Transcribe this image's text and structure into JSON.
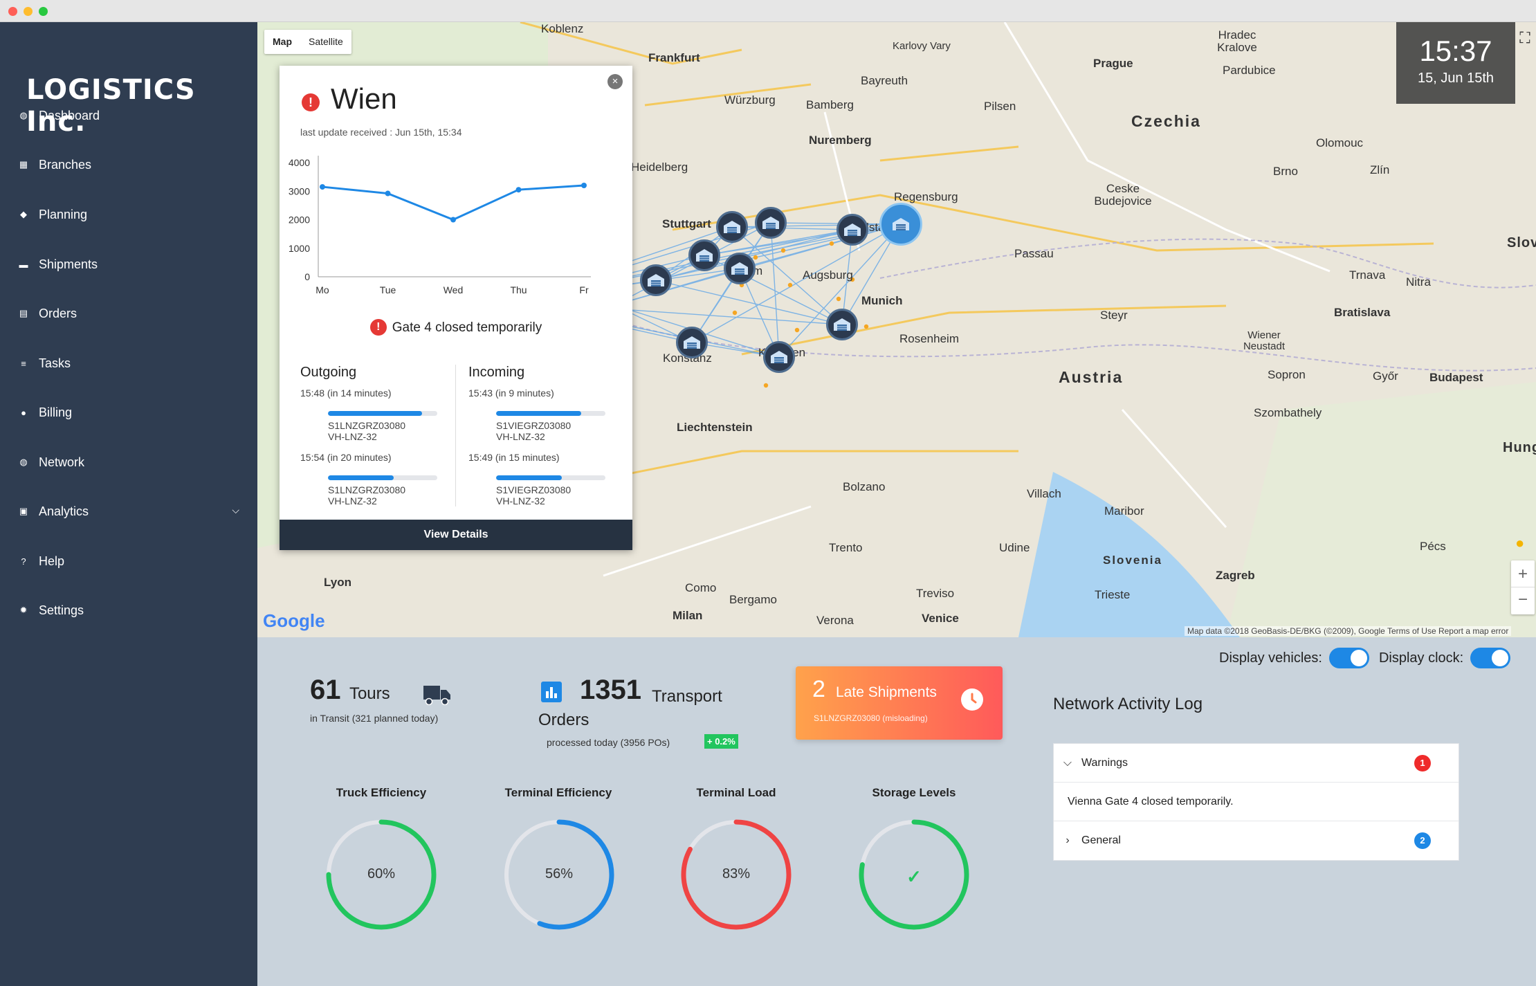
{
  "app": {
    "logo": "LOGISTICS Inc."
  },
  "nav": [
    {
      "label": "Dashboard",
      "icon": "globe-icon"
    },
    {
      "label": "Branches",
      "icon": "building-icon"
    },
    {
      "label": "Planning",
      "icon": "diamond-icon"
    },
    {
      "label": "Shipments",
      "icon": "truck-icon"
    },
    {
      "label": "Orders",
      "icon": "clipboard-icon"
    },
    {
      "label": "Tasks",
      "icon": "list-check-icon"
    },
    {
      "label": "Billing",
      "icon": "coin-icon"
    },
    {
      "label": "Network",
      "icon": "globe-icon"
    },
    {
      "label": "Analytics",
      "icon": "chart-icon"
    },
    {
      "label": "Help",
      "icon": "help-icon"
    },
    {
      "label": "Settings",
      "icon": "gear-icon"
    }
  ],
  "map": {
    "type_map": "Map",
    "type_satellite": "Satellite",
    "clock_time": "15:37",
    "clock_date": "15, Jun 15th",
    "attribution": "Map data ©2018 GeoBasis-DE/BKG (©2009), Google    Terms of Use    Report a map error",
    "google": "Google",
    "labels": {
      "czechia": "Czechia",
      "austria": "Austria",
      "slovenia": "Slovenia",
      "liechtenstein": "Liechtenstein",
      "prague": "Prague",
      "nuremberg": "Nuremberg",
      "munich": "Munich",
      "stuttgart": "Stuttgart",
      "frankfurt": "Frankfurt",
      "wurzburg": "Würzburg",
      "regensburg": "Regensburg",
      "ingolstadt": "Ingolstadt",
      "augsburg": "Augsburg",
      "passau": "Passau",
      "bratislava": "Bratislava",
      "budapest": "Budapest",
      "brno": "Brno",
      "zagreb": "Zagreb",
      "milan": "Milan",
      "venice": "Venice",
      "bolzano": "Bolzano",
      "trieste": "Trieste",
      "lyon": "Lyon",
      "graz": "Maribor",
      "szombathely": "Szombathely",
      "gyor": "Győr",
      "pilsen": "Pilsen",
      "bamberg": "Bamberg",
      "bayreuth": "Bayreuth",
      "ceske": "Ceske Budejovice",
      "ulm": "Ulm",
      "kempten": "Kempten",
      "rosenheim": "Rosenheim",
      "konstanz": "Konstanz",
      "villach": "Villach",
      "trento": "Trento",
      "udine": "Udine",
      "verona": "Verona",
      "como": "Como",
      "bergamo": "Bergamo",
      "treviso": "Treviso",
      "pecs": "Pécs",
      "sopron": "Sopron",
      "olomouc": "Olomouc",
      "zlin": "Zlín",
      "trnava": "Trnava",
      "nitra": "Nitra",
      "wiener_neustadt": "Wiener Neustadt",
      "steyr": "Steyr",
      "hradec": "Hradec Kralove",
      "pardubice": "Pardubice",
      "karlovy": "Karlovy Vary",
      "koblenz": "Koblenz",
      "heidelberg": "Heidelberg",
      "slovak": "Slovak",
      "hung": "Hung"
    }
  },
  "popup": {
    "city": "Wien",
    "update": "last update received : Jun 15th, 15:34",
    "note": "Gate 4 closed temporarily",
    "outgoing_title": "Outgoing",
    "incoming_title": "Incoming",
    "outgoing": [
      {
        "time": "15:48 (in 14 minutes)",
        "progress": 0.86,
        "id1": "S1LNZGRZ03080",
        "id2": "VH-LNZ-32"
      },
      {
        "time": "15:54 (in 20 minutes)",
        "progress": 0.6,
        "id1": "S1LNZGRZ03080",
        "id2": "VH-LNZ-32"
      }
    ],
    "incoming": [
      {
        "time": "15:43 (in 9 minutes)",
        "progress": 0.78,
        "id1": "S1VIEGRZ03080",
        "id2": "VH-LNZ-32"
      },
      {
        "time": "15:49 (in 15 minutes)",
        "progress": 0.6,
        "id1": "S1VIEGRZ03080",
        "id2": "VH-LNZ-32"
      }
    ],
    "view_details": "View Details"
  },
  "chart_data": {
    "type": "line",
    "categories": [
      "Mo",
      "Tue",
      "Wed",
      "Thu",
      "Fr"
    ],
    "values": [
      3150,
      2920,
      2000,
      3050,
      3200
    ],
    "yticks": [
      "0",
      "1000",
      "2000",
      "3000",
      "4000"
    ],
    "ylim": [
      0,
      4000
    ],
    "color": "#1e88e5"
  },
  "toggles": {
    "vehicles": "Display vehicles:",
    "clock": "Display clock:"
  },
  "kpis": {
    "tours_num": "61",
    "tours_label": "Tours",
    "tours_sub": "in Transit (321 planned today)",
    "orders_num": "1351",
    "orders_label1": "Transport",
    "orders_label2": "Orders",
    "orders_sub": "processed today (3956 POs)",
    "orders_delta": "+ 0.2%",
    "late_num": "2",
    "late_label": "Late Shipments",
    "late_sub": "S1LNZGRZ03080 (misloading)"
  },
  "gauges": [
    {
      "title": "Truck Efficiency",
      "value": "60%",
      "fraction": 0.75,
      "color": "#22c55e"
    },
    {
      "title": "Terminal Efficiency",
      "value": "56%",
      "fraction": 0.56,
      "color": "#1e88e5"
    },
    {
      "title": "Terminal Load",
      "value": "83%",
      "fraction": 0.83,
      "color": "#ef4444"
    },
    {
      "title": "Storage Levels",
      "value": "✓",
      "fraction": 0.78,
      "color": "#22c55e"
    }
  ],
  "log": {
    "title": "Network Activity Log",
    "warnings_label": "Warnings",
    "warnings_count": "1",
    "warning_text": "Vienna Gate 4 closed temporarily.",
    "general_label": "General",
    "general_count": "2"
  }
}
